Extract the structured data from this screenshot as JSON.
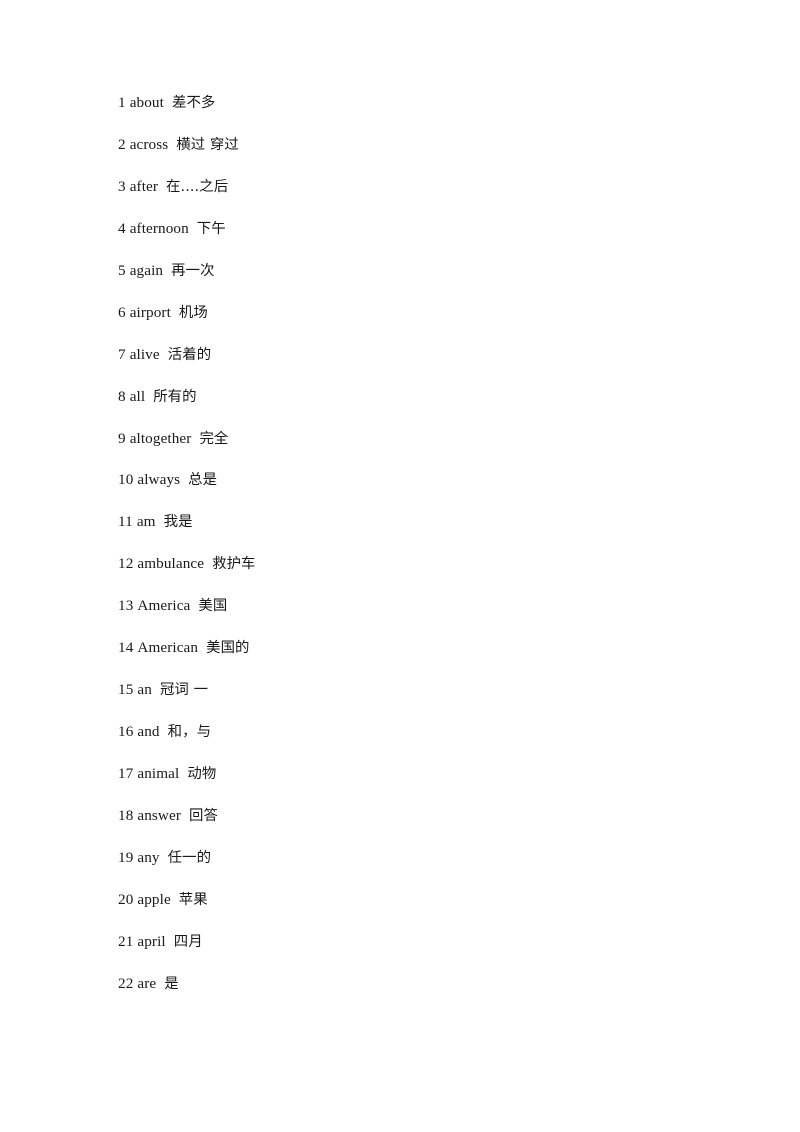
{
  "document": {
    "background_color": "#ffffff",
    "text_color": "#1a1a1a",
    "entries": [
      {
        "index": "1",
        "word": "about",
        "meaning": "差不多"
      },
      {
        "index": "2",
        "word": "across",
        "meaning": "横过 穿过"
      },
      {
        "index": "3",
        "word": "after",
        "meaning": "在....之后"
      },
      {
        "index": "4",
        "word": "afternoon",
        "meaning": "下午"
      },
      {
        "index": "5",
        "word": "again",
        "meaning": "再一次"
      },
      {
        "index": "6",
        "word": "airport",
        "meaning": "机场"
      },
      {
        "index": "7",
        "word": "alive",
        "meaning": "活着的"
      },
      {
        "index": "8",
        "word": "all",
        "meaning": "所有的"
      },
      {
        "index": "9",
        "word": "altogether",
        "meaning": "完全"
      },
      {
        "index": "10",
        "word": "always",
        "meaning": "总是"
      },
      {
        "index": "11",
        "word": "am",
        "meaning": "我是"
      },
      {
        "index": "12",
        "word": "ambulance",
        "meaning": "救护车"
      },
      {
        "index": "13",
        "word": "America",
        "meaning": "美国"
      },
      {
        "index": "14",
        "word": "American",
        "meaning": "美国的"
      },
      {
        "index": "15",
        "word": "an",
        "meaning": "冠词 一"
      },
      {
        "index": "16",
        "word": "and",
        "meaning": "和，与"
      },
      {
        "index": "17",
        "word": "animal",
        "meaning": "动物"
      },
      {
        "index": "18",
        "word": "answer",
        "meaning": "回答"
      },
      {
        "index": "19",
        "word": "any",
        "meaning": "任一的"
      },
      {
        "index": "20",
        "word": "apple",
        "meaning": "苹果"
      },
      {
        "index": "21",
        "word": "april",
        "meaning": "四月"
      },
      {
        "index": "22",
        "word": "are",
        "meaning": "是"
      }
    ]
  }
}
